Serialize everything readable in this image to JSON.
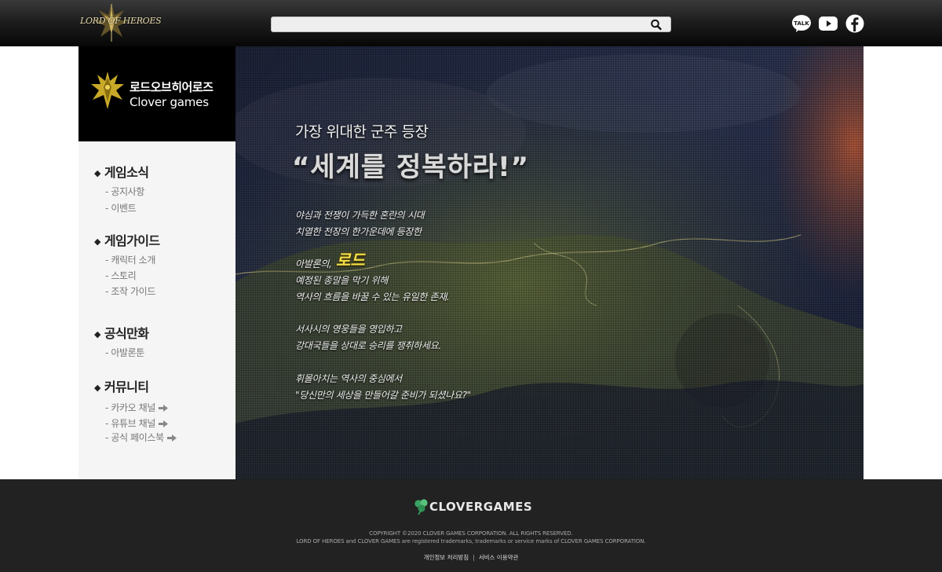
{
  "header": {
    "logo_text": "LORD OF HEROES",
    "search": {
      "value": "",
      "placeholder": ""
    },
    "social": [
      "kakaotalk-icon",
      "youtube-icon",
      "facebook-icon"
    ]
  },
  "brand": {
    "name": "로드오브히어로즈",
    "company": "Clover games"
  },
  "sidebar": {
    "sections": [
      {
        "title": "게임소식",
        "items": [
          "- 공지사항",
          "- 이벤트"
        ]
      },
      {
        "title": "게임가이드",
        "items": [
          "- 캐릭터 소개",
          "- 스토리",
          "- 조작 가이드"
        ]
      },
      {
        "title": "공식만화",
        "items": [
          "- 아발론툰"
        ]
      },
      {
        "title": "커뮤니티",
        "items": [
          "- 카카오 채널",
          "- 유튜브 채널",
          "- 공식 페이스북"
        ]
      }
    ]
  },
  "hero": {
    "subtitle": "가장 위대한 군주 등장",
    "title": "“세계를 정복하라!”",
    "lines": [
      "야심과 전쟁이 가득한 혼란의 시대",
      "치열한 전장의 한가운데에 등장한",
      "아발론의,",
      "예정된 종말을 막기 위해",
      "역사의 흐름을 바꿀 수 있는 유일한 존재.",
      "서사시의 영웅들을 영입하고",
      "강대국들을 상대로 승리를 쟁취하세요.",
      "휘몰아치는 역사의 중심에서",
      "\"당신만의 세상을 만들어갈 준비가 되셨나요?\""
    ],
    "highlight": "로드"
  },
  "footer": {
    "logo_text": "CLOVERGAMES",
    "copyright_line1": "COPYRIGHT ©2020 CLOVER GAMES CORPORATION. ALL RIGHTS RESERVED.",
    "copyright_line2": "LORD OF HEROES and CLOVER GAMES are registered trademarks, trademarks or service marks of CLOVER GAMES CORPORATION.",
    "links": [
      "개인정보 처리방침",
      "서비스 이용약관"
    ],
    "link_separator": "|"
  },
  "colors": {
    "header_bg": "#1a1a1a",
    "sidebar_bg": "#f5f5f5",
    "footer_bg": "#222222",
    "highlight": "#f3e04a"
  }
}
